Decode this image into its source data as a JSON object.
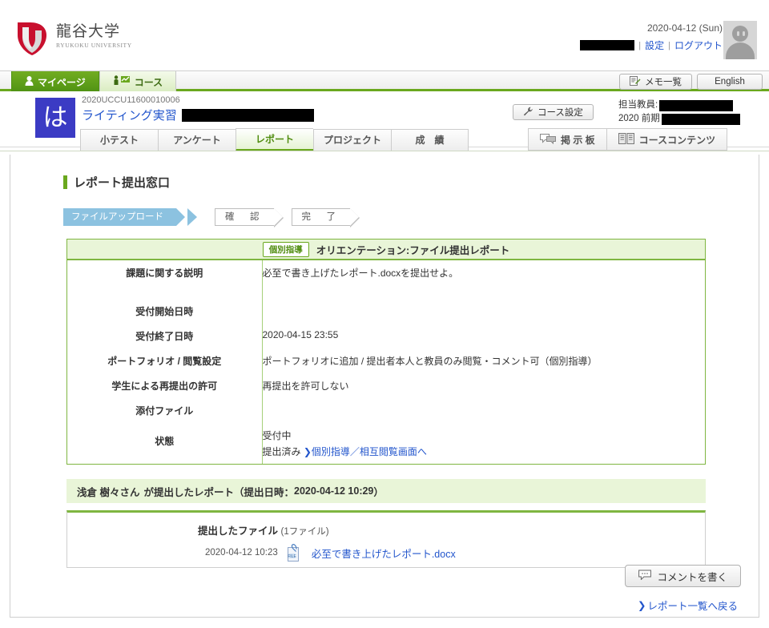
{
  "header": {
    "logo_jp": "龍谷大学",
    "logo_en": "RYUKOKU UNIVERSITY",
    "logo_icon": "ryukoku-logo-icon",
    "date": "2020-04-12 (Sun)",
    "user_name_redacted": "",
    "separator": "|",
    "settings_link": "設定",
    "logout_link": "ログアウト",
    "avatar_icon": "user-avatar-icon"
  },
  "global_nav": {
    "tabs": [
      {
        "label": "マイページ",
        "icon": "person-icon",
        "active": true
      },
      {
        "label": "コース",
        "icon": "course-chart-icon",
        "active": false
      }
    ],
    "memo_button": "メモ一覧",
    "memo_icon": "memo-pencil-icon",
    "english_button": "English"
  },
  "course": {
    "badge_char": "は",
    "code": "2020UCCU11600010006",
    "title": "ライティング実習",
    "title_redacted": "",
    "settings_button": "コース設定",
    "settings_icon": "wrench-icon",
    "teacher_label": "担当教員:",
    "teacher_redacted": "",
    "term_label": "2020 前期",
    "term_redacted": "",
    "tabs": [
      {
        "label": "小テスト",
        "active": false
      },
      {
        "label": "アンケート",
        "active": false
      },
      {
        "label": "レポート",
        "active": true
      },
      {
        "label": "プロジェクト",
        "active": false
      },
      {
        "label": "成　績",
        "active": false
      }
    ],
    "right_tabs": [
      {
        "label": "掲 示 板",
        "icon": "speech-bubbles-icon"
      },
      {
        "label": "コースコンテンツ",
        "icon": "book-icon"
      }
    ]
  },
  "main": {
    "page_title": "レポート提出窓口",
    "steps": [
      {
        "label": "ファイルアップロード",
        "state": "done"
      },
      {
        "label": "確　認",
        "state": "todo"
      },
      {
        "label": "完　了",
        "state": "todo"
      }
    ],
    "assignment": {
      "badge": "個別指導",
      "title": "オリエンテーション:ファイル提出レポート",
      "rows": [
        {
          "label": "課題に関する説明",
          "value": "必至で書き上げたレポート.docxを提出せよ。"
        },
        {
          "label": "受付開始日時",
          "value": ""
        },
        {
          "label": "受付終了日時",
          "value": "2020-04-15 23:55"
        },
        {
          "label": "ポートフォリオ / 閲覧設定",
          "value": "ポートフォリオに追加 / 提出者本人と教員のみ閲覧・コメント可（個別指導）"
        },
        {
          "label": "学生による再提出の許可",
          "value": "再提出を許可しない"
        },
        {
          "label": "添付ファイル",
          "value": ""
        }
      ],
      "status_label": "状態",
      "status_value": "受付中",
      "status_submitted": "提出済み",
      "status_link": "個別指導／相互閲覧画面へ"
    },
    "submission": {
      "bar_name": "浅倉 樹々さん",
      "bar_text": "が提出したレポート（提出日時：",
      "bar_datetime": "2020-04-12 10:29",
      "bar_close": "）",
      "files_title": "提出したファイル",
      "files_count": "(1ファイル)",
      "file_date": "2020-04-12 10:23",
      "file_icon": "file-attachment-icon",
      "file_name": "必至で書き上げたレポート.docx"
    },
    "comment_button": "コメントを書く",
    "comment_icon": "speech-bubble-icon",
    "back_link": "レポート一覧へ戻る",
    "back_arrow": "❯"
  },
  "colors": {
    "accent_green": "#6aa81e",
    "link_blue": "#2255cc",
    "step_blue": "#8cc2e0",
    "panel_green_bg": "#e9f5d8",
    "badge_indigo": "#3b3bc4",
    "logo_red": "#c8102e"
  }
}
